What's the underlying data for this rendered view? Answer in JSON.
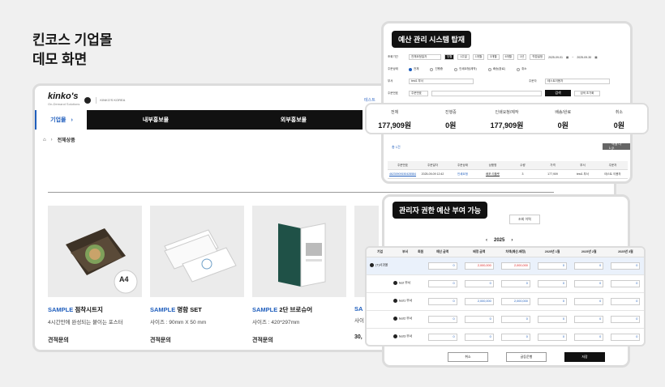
{
  "headline": {
    "line1": "킨코스 기업몰",
    "line2": "데모 화면"
  },
  "mall": {
    "logo": "kinko's",
    "logo_sub": "On-Demand Solutions",
    "subbrand": "KINKO'S KOREA",
    "top_link": "테스트",
    "nav": {
      "active": "기업몰",
      "items": [
        "내부홍보물",
        "외부홍보물"
      ]
    },
    "breadcrumb": "전체상품",
    "products": [
      {
        "badge": "SAMPLE",
        "name": "점착시트지",
        "desc": "4시간만에 완성되는 붙이는 포스터",
        "price": "견적문의",
        "img_label": "A4"
      },
      {
        "badge": "SAMPLE",
        "name": "명함 SET",
        "desc": "사이즈 : 90mm X 50 mm",
        "price": "견적문의"
      },
      {
        "badge": "SAMPLE",
        "name": "2단 브로슈어",
        "desc": "사이즈 : 420*297mm",
        "price": "견적문의"
      },
      {
        "badge": "SA",
        "name": "",
        "desc": "사이",
        "price": "30,"
      }
    ]
  },
  "budget": {
    "title": "예산 관리 시스템 탑재",
    "form": {
      "period_label": "조회기간",
      "period_select": "전체요청일자",
      "period_buttons": [
        "당월",
        "1주일",
        "1개월",
        "3개월",
        "6개월",
        "1년",
        "직접설정"
      ],
      "date_from": "2025-09-01",
      "date_to": "2025-09-30",
      "status_label": "주문상태",
      "statuses": [
        "전체",
        "진행중",
        "인쇄요청(제작)",
        "배송(완료)",
        "취소"
      ],
      "dept_label": "부서",
      "dept_value": "test1 부서",
      "orderer_label": "주문자",
      "orderer_value": "테스트이용자",
      "order_no_label": "주문번호",
      "order_no_select": "주문번호",
      "search_button": "검색",
      "reset_button": "검색 초기화"
    },
    "count": "총 1건",
    "excel_button": "엑셀 다운",
    "table_headers": [
      "주문번호",
      "주문일자",
      "주문상태",
      "상품명",
      "수량",
      "가격",
      "부서",
      "주문자"
    ],
    "table_row": [
      "46230909150428584",
      "2025-09-09 12:42",
      "인쇄요청",
      "배포 리플렛",
      "3",
      "177,909",
      "test1 부서",
      "테스트 이용자"
    ]
  },
  "summary": [
    {
      "label": "전체",
      "value": "177,909원"
    },
    {
      "label": "진행중",
      "value": "0원"
    },
    {
      "label": "인쇄요청/제작",
      "value": "177,909원"
    },
    {
      "label": "배송/완료",
      "value": "0원"
    },
    {
      "label": "취소",
      "value": "0원"
    }
  ],
  "admin": {
    "title": "관리자 권한 예산 부여 가능",
    "tab": "조회 이력",
    "year": "2025",
    "buttons": [
      "취소",
      "글등운행",
      "저장"
    ]
  },
  "grid": {
    "headers": [
      "기업",
      "부서",
      "회원",
      "예산 금액",
      "배정 금액",
      "차액(예산-배정)",
      "2025년 1월",
      "2025년 2월",
      "2025년 3월"
    ],
    "rows": [
      {
        "company": "(T)사과몰",
        "dept": "",
        "budget": "0",
        "assigned": "2,000,000",
        "diff": "2,000,000",
        "m1": "0",
        "m2": "0",
        "m3": "0"
      },
      {
        "company": "",
        "dept": "test 부서",
        "budget": "0",
        "assigned": "0",
        "diff": "0",
        "m1": "0",
        "m2": "0",
        "m3": "0"
      },
      {
        "company": "",
        "dept": "test1 부서",
        "budget": "0",
        "assigned": "2,000,000",
        "diff": "2,000,000",
        "m1": "0",
        "m2": "0",
        "m3": "0"
      },
      {
        "company": "",
        "dept": "test2 부서",
        "budget": "0",
        "assigned": "0",
        "diff": "0",
        "m1": "0",
        "m2": "0",
        "m3": "0"
      },
      {
        "company": "",
        "dept": "test3 부서",
        "budget": "0",
        "assigned": "0",
        "diff": "0",
        "m1": "0",
        "m2": "0",
        "m3": "0"
      }
    ]
  }
}
